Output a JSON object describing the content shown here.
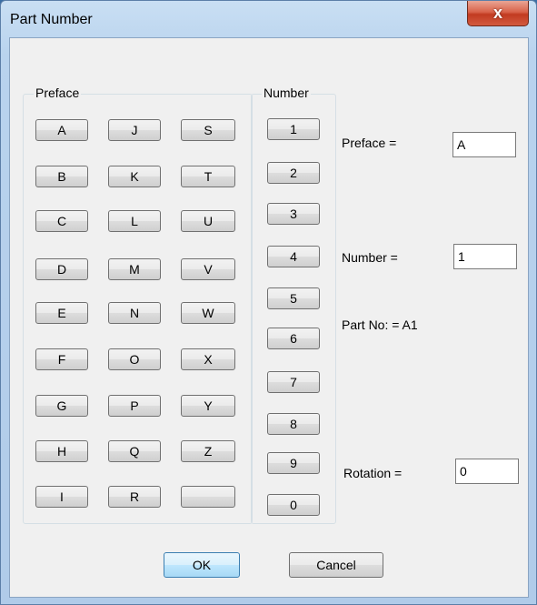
{
  "window": {
    "title": "Part Number",
    "close_label": "x"
  },
  "preface_group": {
    "label": "Preface",
    "columns": [
      [
        "A",
        "B",
        "C",
        "D",
        "E",
        "F",
        "G",
        "H",
        "I"
      ],
      [
        "J",
        "K",
        "L",
        "M",
        "N",
        "O",
        "P",
        "Q",
        "R"
      ],
      [
        "S",
        "T",
        "U",
        "V",
        "W",
        "X",
        "Y",
        "Z",
        ""
      ]
    ]
  },
  "number_group": {
    "label": "Number",
    "buttons": [
      "1",
      "2",
      "3",
      "4",
      "5",
      "6",
      "7",
      "8",
      "9",
      "0"
    ]
  },
  "fields": {
    "preface_label": "Preface =",
    "preface_value": "A",
    "number_label": "Number =",
    "number_value": "1",
    "part_no_text": "Part No: = A1",
    "rotation_label": "Rotation =",
    "rotation_value": "0"
  },
  "footer": {
    "ok_label": "OK",
    "cancel_label": "Cancel"
  }
}
